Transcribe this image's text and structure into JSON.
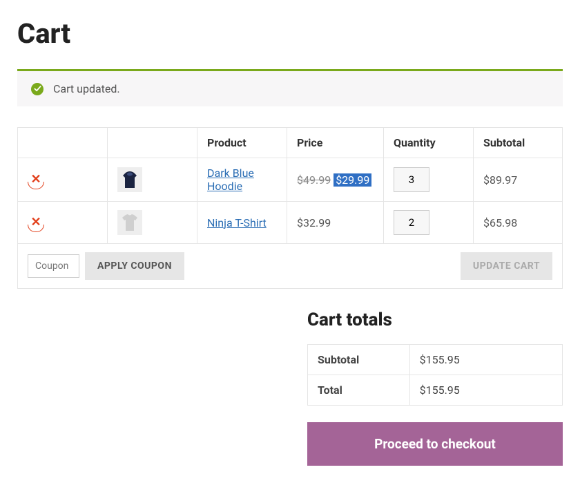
{
  "page": {
    "title": "Cart"
  },
  "notice": {
    "message": "Cart updated."
  },
  "table": {
    "headers": {
      "product": "Product",
      "price": "Price",
      "quantity": "Quantity",
      "subtotal": "Subtotal"
    },
    "rows": [
      {
        "remove_icon": "close-icon",
        "thumb_icon": "hoodie-icon",
        "name": "Dark Blue Hoodie",
        "original_price": "$49.99",
        "sale_price": "$29.99",
        "quantity": "3",
        "subtotal": "$89.97"
      },
      {
        "remove_icon": "close-icon",
        "thumb_icon": "tshirt-icon",
        "name": "Ninja T-Shirt",
        "price": "$32.99",
        "quantity": "2",
        "subtotal": "$65.98"
      }
    ]
  },
  "actions": {
    "coupon_placeholder": "Coupon",
    "apply_coupon": "Apply Coupon",
    "update_cart": "Update Cart"
  },
  "totals": {
    "heading": "Cart totals",
    "subtotal_label": "Subtotal",
    "subtotal_value": "$155.95",
    "total_label": "Total",
    "total_value": "$155.95"
  },
  "checkout": {
    "label": "Proceed to checkout"
  }
}
